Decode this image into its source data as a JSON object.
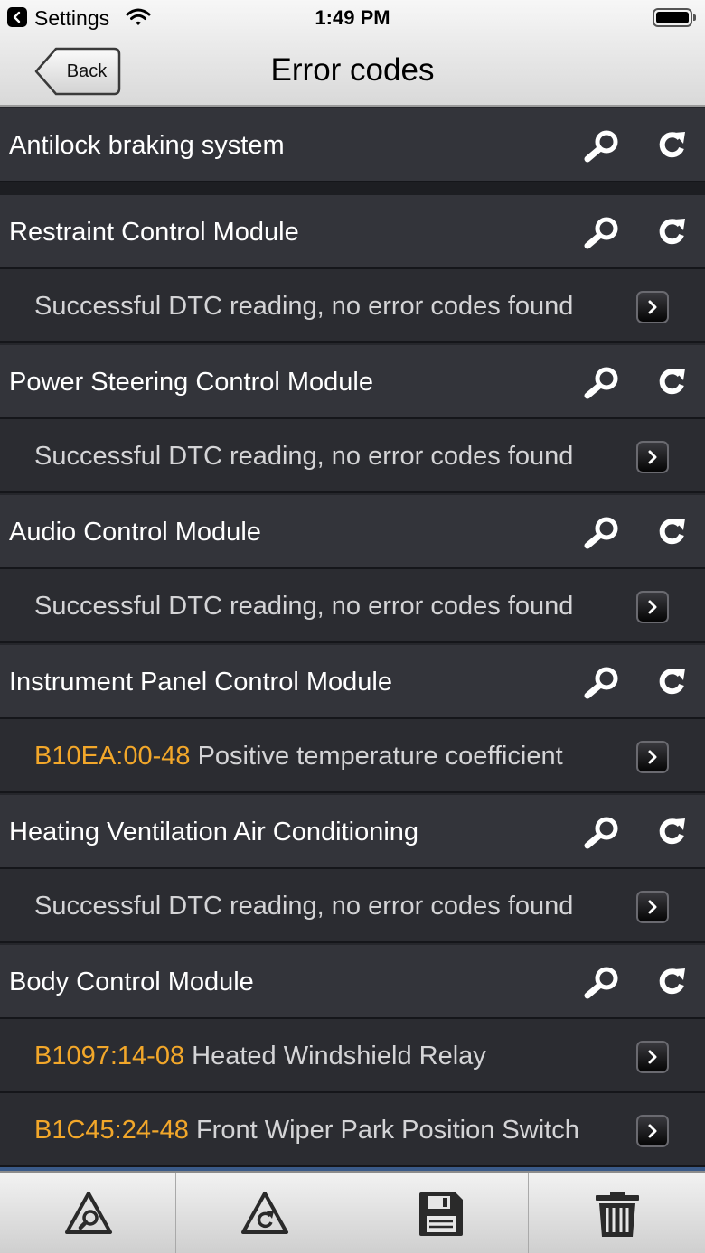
{
  "status_bar": {
    "back_app": "Settings",
    "time": "1:49 PM"
  },
  "nav": {
    "back_label": "Back",
    "title": "Error codes"
  },
  "rows": [
    {
      "kind": "module",
      "label": "Antilock braking system"
    },
    {
      "kind": "module",
      "label": "Restraint Control Module"
    },
    {
      "kind": "result",
      "code": "",
      "text": "Successful DTC reading, no error codes found"
    },
    {
      "kind": "module",
      "label": "Power Steering Control Module"
    },
    {
      "kind": "result",
      "code": "",
      "text": "Successful DTC reading, no error codes found"
    },
    {
      "kind": "module",
      "label": "Audio Control Module"
    },
    {
      "kind": "result",
      "code": "",
      "text": "Successful DTC reading, no error codes found"
    },
    {
      "kind": "module",
      "label": "Instrument Panel Control Module"
    },
    {
      "kind": "result",
      "code": "B10EA:00-48",
      "text": "Positive temperature coefficient"
    },
    {
      "kind": "module",
      "label": "Heating Ventilation Air Conditioning"
    },
    {
      "kind": "result",
      "code": "",
      "text": "Successful DTC reading, no error codes found"
    },
    {
      "kind": "module",
      "label": "Body Control Module"
    },
    {
      "kind": "result",
      "code": "B1097:14-08",
      "text": "Heated Windshield Relay"
    },
    {
      "kind": "result",
      "code": "B1C45:24-48",
      "text": "Front Wiper Park Position Switch"
    }
  ],
  "toolbar": {
    "icons": [
      "warning-search-icon",
      "warning-refresh-icon",
      "save-icon",
      "trash-icon"
    ]
  },
  "colors": {
    "code": "#f2a72a",
    "module_bg": "#33343a",
    "result_bg": "#2b2c31",
    "nav_title": "#000000"
  }
}
